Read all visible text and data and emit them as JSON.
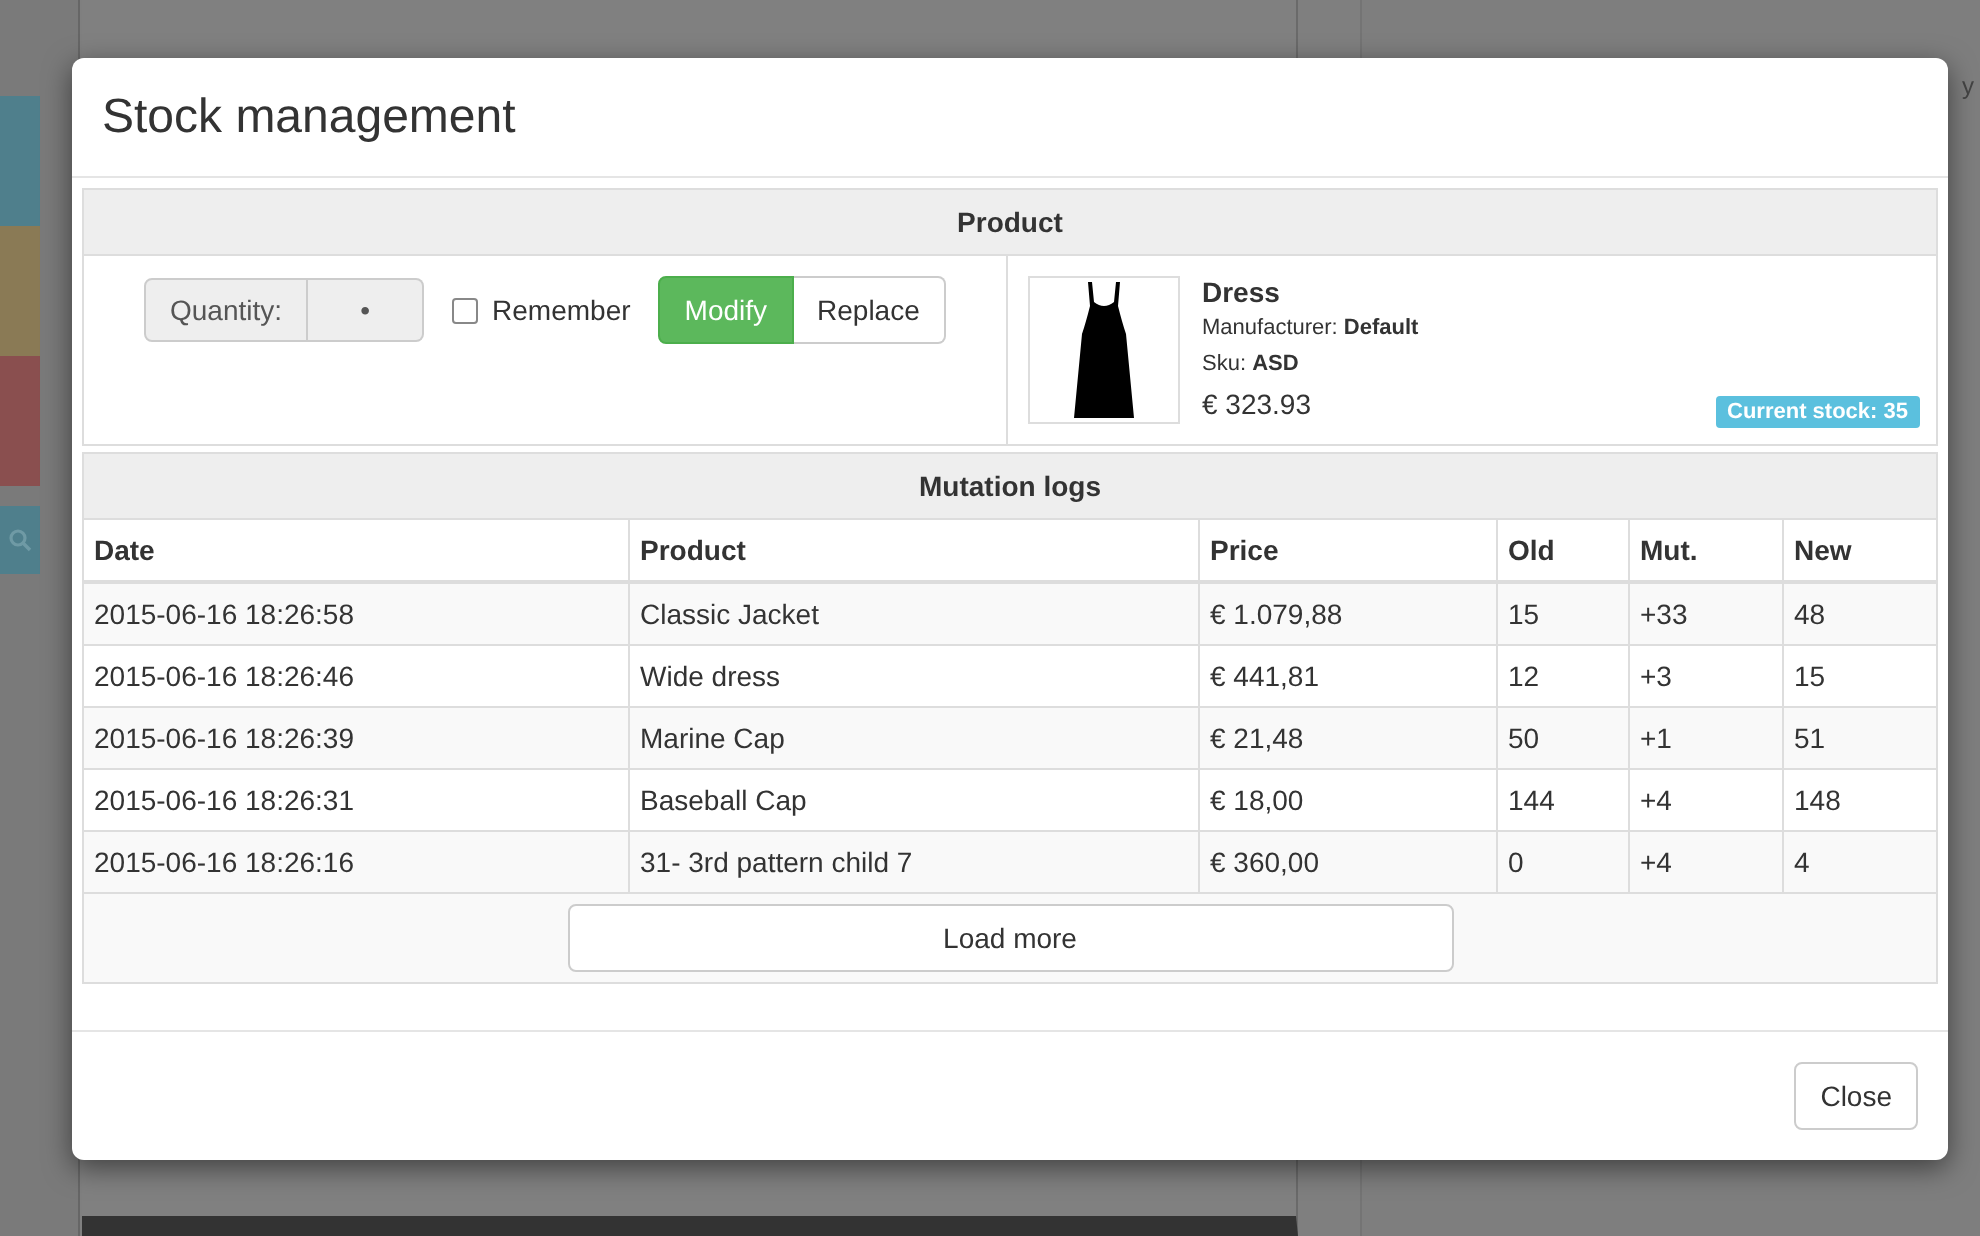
{
  "background": {
    "tiles": [
      {
        "color": "#4f7f8c"
      },
      {
        "color": "#8a7a55"
      },
      {
        "color": "#8a4f4f"
      }
    ],
    "partial_text": "y"
  },
  "modal": {
    "title": "Stock management",
    "product_section": {
      "heading": "Product",
      "quantity": {
        "label": "Quantity:",
        "value": "•"
      },
      "remember": {
        "label": "Remember",
        "checked": false
      },
      "modes": [
        {
          "label": "Modify",
          "selected": true
        },
        {
          "label": "Replace",
          "selected": false
        }
      ],
      "product": {
        "name": "Dress",
        "manufacturer_label": "Manufacturer:",
        "manufacturer": "Default",
        "sku_label": "Sku:",
        "sku": "ASD",
        "price": "€ 323.93",
        "stock_badge": "Current stock: 35"
      }
    },
    "mutation_logs": {
      "heading": "Mutation logs",
      "columns": [
        "Date",
        "Product",
        "Price",
        "Old",
        "Mut.",
        "New"
      ],
      "rows": [
        [
          "2015-06-16 18:26:58",
          "Classic Jacket",
          "€ 1.079,88",
          "15",
          "+33",
          "48"
        ],
        [
          "2015-06-16 18:26:46",
          "Wide dress",
          "€ 441,81",
          "12",
          "+3",
          "15"
        ],
        [
          "2015-06-16 18:26:39",
          "Marine Cap",
          "€ 21,48",
          "50",
          "+1",
          "51"
        ],
        [
          "2015-06-16 18:26:31",
          "Baseball Cap",
          "€ 18,00",
          "144",
          "+4",
          "148"
        ],
        [
          "2015-06-16 18:26:16",
          "31- 3rd pattern child 7",
          "€ 360,00",
          "0",
          "+4",
          "4"
        ]
      ],
      "load_more": "Load more"
    },
    "close_button": "Close"
  }
}
